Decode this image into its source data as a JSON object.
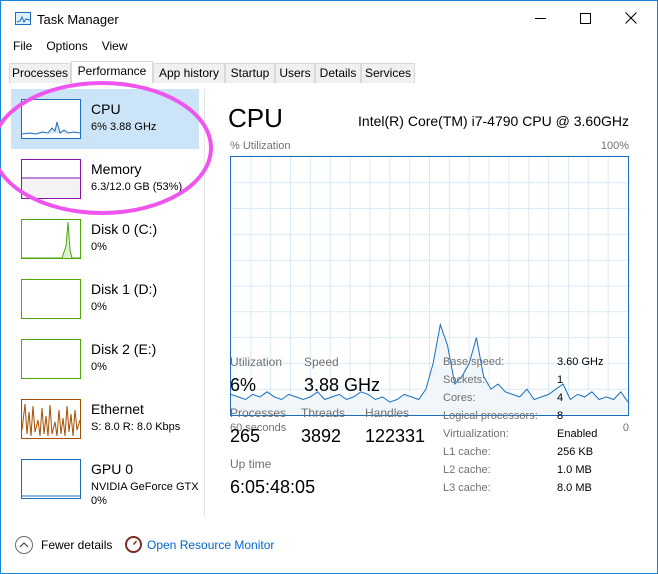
{
  "window": {
    "title": "Task Manager",
    "accent_color": "#1883d7",
    "app_icon": "task-manager-icon"
  },
  "menu": {
    "items": [
      "File",
      "Options",
      "View"
    ]
  },
  "tabs": {
    "items": [
      "Processes",
      "Performance",
      "App history",
      "Startup",
      "Users",
      "Details",
      "Services"
    ],
    "active": "Performance"
  },
  "sidebar": {
    "items": [
      {
        "name": "CPU",
        "line1": "6%  3.88 GHz",
        "line2": "",
        "color": "#1a6ebd",
        "selected": true
      },
      {
        "name": "Memory",
        "line1": "6.3/12.0 GB (53%)",
        "line2": "",
        "color": "#8b12ae"
      },
      {
        "name": "Disk 0 (C:)",
        "line1": "0%",
        "line2": "",
        "color": "#4da60c"
      },
      {
        "name": "Disk 1 (D:)",
        "line1": "0%",
        "line2": "",
        "color": "#4da60c"
      },
      {
        "name": "Disk 2 (E:)",
        "line1": "0%",
        "line2": "",
        "color": "#4da60c"
      },
      {
        "name": "Ethernet",
        "line1": "S: 8.0  R: 8.0 Kbps",
        "line2": "",
        "color": "#a74f01"
      },
      {
        "name": "GPU 0",
        "line1": "NVIDIA GeForce GTX",
        "line2": "0%",
        "color": "#1a6ebd"
      }
    ]
  },
  "main": {
    "title": "CPU",
    "model": "Intel(R) Core(TM) i7-4790 CPU @ 3.60GHz",
    "graph": {
      "ylabel": "% Utilization",
      "ymax_label": "100%",
      "xleft_label": "60 seconds",
      "xright_label": "0",
      "ylim": [
        0,
        100
      ],
      "values": [
        8,
        7,
        6,
        8,
        7,
        9,
        7,
        6,
        8,
        7,
        6,
        7,
        9,
        6,
        7,
        8,
        6,
        7,
        9,
        8,
        6,
        7,
        5,
        6,
        8,
        7,
        6,
        10,
        20,
        35,
        27,
        12,
        15,
        20,
        30,
        15,
        10,
        12,
        9,
        8,
        7,
        10,
        6,
        7,
        8,
        10,
        12,
        6,
        8,
        7,
        9,
        6,
        7,
        6,
        9,
        5
      ]
    },
    "stats": {
      "utilization_label": "Utilization",
      "utilization": "6%",
      "speed_label": "Speed",
      "speed": "3.88 GHz",
      "processes_label": "Processes",
      "processes": "265",
      "threads_label": "Threads",
      "threads": "3892",
      "handles_label": "Handles",
      "handles": "122331",
      "uptime_label": "Up time",
      "uptime": "6:05:48:05"
    },
    "specs": [
      {
        "label": "Base speed:",
        "value": "3.60 GHz"
      },
      {
        "label": "Sockets:",
        "value": "1"
      },
      {
        "label": "Cores:",
        "value": "4"
      },
      {
        "label": "Logical processors:",
        "value": "8"
      },
      {
        "label": "Virtualization:",
        "value": "Enabled"
      },
      {
        "label": "L1 cache:",
        "value": "256 KB"
      },
      {
        "label": "L2 cache:",
        "value": "1.0 MB"
      },
      {
        "label": "L3 cache:",
        "value": "8.0 MB"
      }
    ]
  },
  "footer": {
    "fewer_details": "Fewer details",
    "resource_monitor": "Open Resource Monitor"
  }
}
